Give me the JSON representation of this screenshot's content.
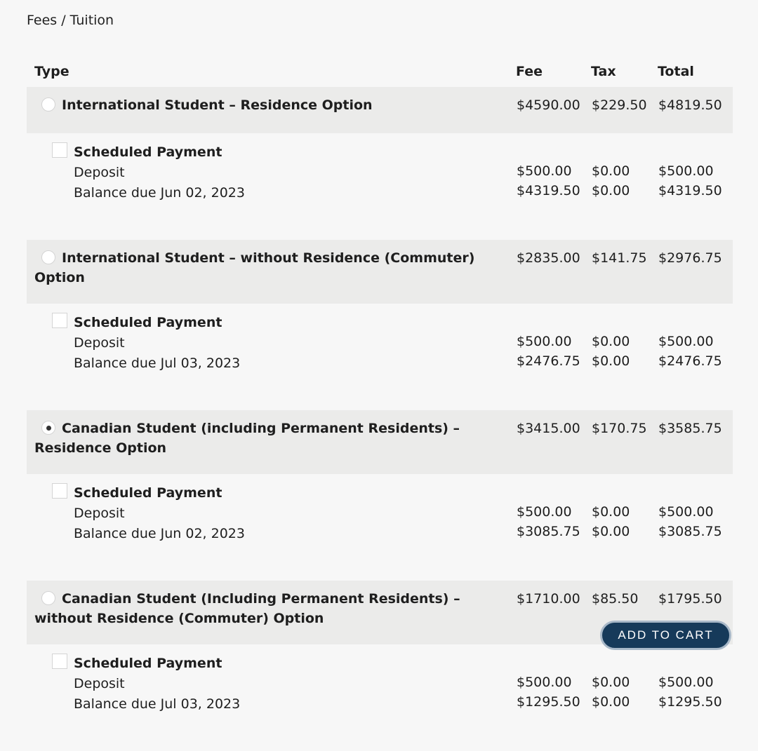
{
  "page": {
    "title": "Fees / Tuition"
  },
  "table": {
    "headers": {
      "type": "Type",
      "fee": "Fee",
      "tax": "Tax",
      "total": "Total"
    },
    "options": [
      {
        "label": "International Student – Residence Option",
        "selected": false,
        "fee": "$4590.00",
        "tax": "$229.50",
        "total": "$4819.50",
        "schedule": {
          "label": "Scheduled Payment",
          "checked": false,
          "deposit_label": "Deposit",
          "balance_label": "Balance due Jun 02, 2023",
          "deposit": {
            "fee": "$500.00",
            "tax": "$0.00",
            "total": "$500.00"
          },
          "balance": {
            "fee": "$4319.50",
            "tax": "$0.00",
            "total": "$4319.50"
          }
        }
      },
      {
        "label": "International Student – without Residence (Commuter) Option",
        "selected": false,
        "fee": "$2835.00",
        "tax": "$141.75",
        "total": "$2976.75",
        "schedule": {
          "label": "Scheduled Payment",
          "checked": false,
          "deposit_label": "Deposit",
          "balance_label": "Balance due Jul 03, 2023",
          "deposit": {
            "fee": "$500.00",
            "tax": "$0.00",
            "total": "$500.00"
          },
          "balance": {
            "fee": "$2476.75",
            "tax": "$0.00",
            "total": "$2476.75"
          }
        }
      },
      {
        "label": "Canadian Student (including Permanent Residents) – Residence Option",
        "selected": true,
        "fee": "$3415.00",
        "tax": "$170.75",
        "total": "$3585.75",
        "schedule": {
          "label": "Scheduled Payment",
          "checked": false,
          "deposit_label": "Deposit",
          "balance_label": "Balance due Jun 02, 2023",
          "deposit": {
            "fee": "$500.00",
            "tax": "$0.00",
            "total": "$500.00"
          },
          "balance": {
            "fee": "$3085.75",
            "tax": "$0.00",
            "total": "$3085.75"
          }
        }
      },
      {
        "label": "Canadian Student (Including Permanent Residents) – without Residence (Commuter) Option",
        "selected": false,
        "fee": "$1710.00",
        "tax": "$85.50",
        "total": "$1795.50",
        "schedule": {
          "label": "Scheduled Payment",
          "checked": false,
          "deposit_label": "Deposit",
          "balance_label": "Balance due Jul 03, 2023",
          "deposit": {
            "fee": "$500.00",
            "tax": "$0.00",
            "total": "$500.00"
          },
          "balance": {
            "fee": "$1295.50",
            "tax": "$0.00",
            "total": "$1295.50"
          }
        }
      }
    ]
  },
  "actions": {
    "add_to_cart": "ADD TO CART"
  }
}
